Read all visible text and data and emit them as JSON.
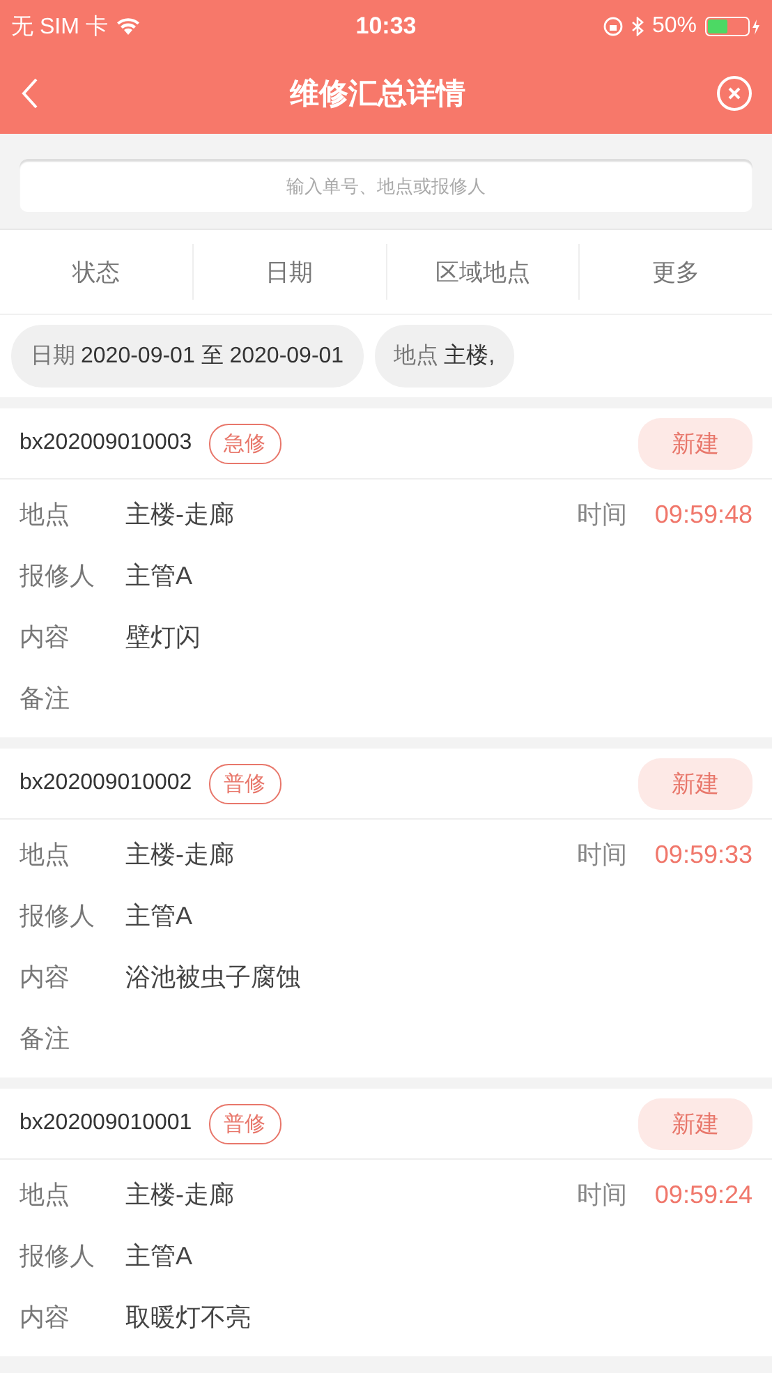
{
  "status_bar": {
    "carrier": "无 SIM 卡",
    "time": "10:33",
    "battery": "50%"
  },
  "header": {
    "title": "维修汇总详情"
  },
  "search": {
    "placeholder": "输入单号、地点或报修人"
  },
  "filter_tabs": [
    {
      "label": "状态"
    },
    {
      "label": "日期"
    },
    {
      "label": "区域地点"
    },
    {
      "label": "更多"
    }
  ],
  "chips": [
    {
      "label": "日期",
      "value": "2020-09-01 至 2020-09-01"
    },
    {
      "label": "地点",
      "value": "主楼,"
    }
  ],
  "orders": [
    {
      "number": "bx202009010003",
      "tag": "急修",
      "status": "新建",
      "fields": [
        {
          "label": "地点",
          "value": "主楼-走廊",
          "aside_label": "时间",
          "aside_value": "09:59:48"
        },
        {
          "label": "报修人",
          "value": "主管A"
        },
        {
          "label": "内容",
          "value": "壁灯闪"
        },
        {
          "label": "备注"
        }
      ]
    },
    {
      "number": "bx202009010002",
      "tag": "普修",
      "status": "新建",
      "fields": [
        {
          "label": "地点",
          "value": "主楼-走廊",
          "aside_label": "时间",
          "aside_value": "09:59:33"
        },
        {
          "label": "报修人",
          "value": "主管A"
        },
        {
          "label": "内容",
          "value": "浴池被虫子腐蚀"
        },
        {
          "label": "备注"
        }
      ]
    },
    {
      "number": "bx202009010001",
      "tag": "普修",
      "status": "新建",
      "fields": [
        {
          "label": "地点",
          "value": "主楼-走廊",
          "aside_label": "时间",
          "aside_value": "09:59:24"
        },
        {
          "label": "报修人",
          "value": "主管A"
        },
        {
          "label": "内容",
          "value": "取暖灯不亮"
        }
      ]
    }
  ]
}
